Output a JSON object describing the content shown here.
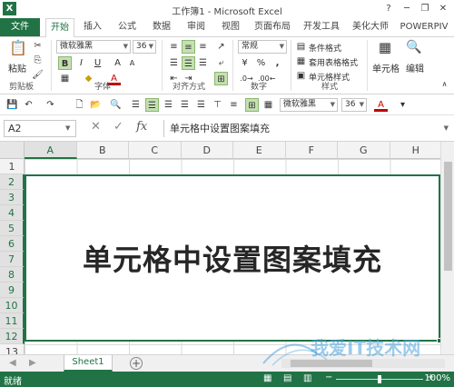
{
  "window": {
    "title": "工作簿1 - Microsoft Excel",
    "help": "?",
    "minimize": "─",
    "restore": "❐",
    "close": "✕"
  },
  "ribbon_tabs": [
    "文件",
    "开始",
    "插入",
    "公式",
    "数据",
    "审阅",
    "视图",
    "页面布局",
    "开发工具",
    "美化大师",
    "POWERPIV"
  ],
  "ribbon": {
    "paste": "粘贴",
    "clipboard": "剪贴板",
    "font_name": "微软雅黑",
    "font_size": "36",
    "font_group": "字体",
    "align_group": "对齐方式",
    "number_format": "常规",
    "number_group": "数字",
    "cond_format": "条件格式",
    "table_format": "套用表格格式",
    "cell_styles": "单元格样式",
    "styles_group": "样式",
    "cells_btn": "单元格",
    "edit_btn": "编辑",
    "bold": "B",
    "italic": "I",
    "underline": "U",
    "font_color": "A",
    "grow": "A",
    "shrink": "A",
    "currency": "¥",
    "percent": "%",
    "comma": ","
  },
  "quick_bar": {
    "font_name": "微软雅黑",
    "font_size": "36",
    "font_color": "A"
  },
  "formula_bar": {
    "cell_ref": "A2",
    "fx": "fx",
    "content": "单元格中设置图案填充"
  },
  "grid": {
    "columns": [
      "A",
      "B",
      "C",
      "D",
      "E",
      "F",
      "G",
      "H"
    ],
    "rows": [
      "1",
      "2",
      "3",
      "4",
      "5",
      "6",
      "7",
      "8",
      "9",
      "10",
      "11",
      "12",
      "13"
    ],
    "merged_text": "单元格中设置图案填充"
  },
  "sheets": {
    "active": "Sheet1",
    "add": "+"
  },
  "status": {
    "left": "就绪",
    "zoom": "100%"
  },
  "colors": {
    "accent": "#217346",
    "watermark": "#4aa3df"
  }
}
